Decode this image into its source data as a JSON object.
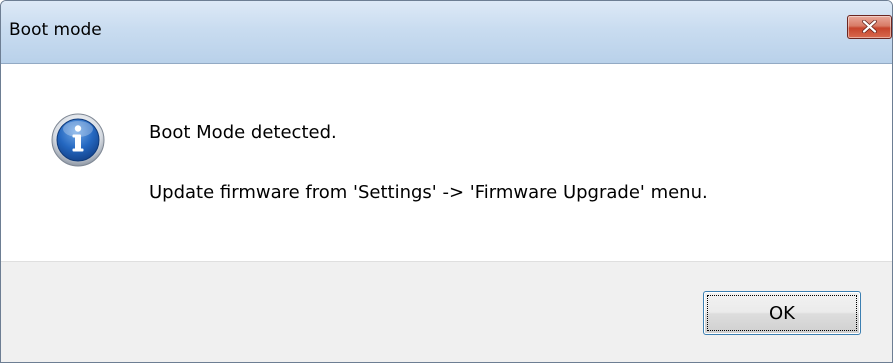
{
  "window": {
    "title": "Boot mode"
  },
  "icons": {
    "close": "close-icon",
    "info": "information-icon"
  },
  "message": {
    "line1": "Boot Mode detected.",
    "line2": "Update firmware from 'Settings' -> 'Firmware Upgrade' menu."
  },
  "buttons": {
    "ok_label": "OK"
  },
  "colors": {
    "close_button": "#c6442c",
    "info_icon": "#1b5fb4",
    "footer_bg": "#f0f0f0",
    "ok_border": "#3c7fb1"
  }
}
